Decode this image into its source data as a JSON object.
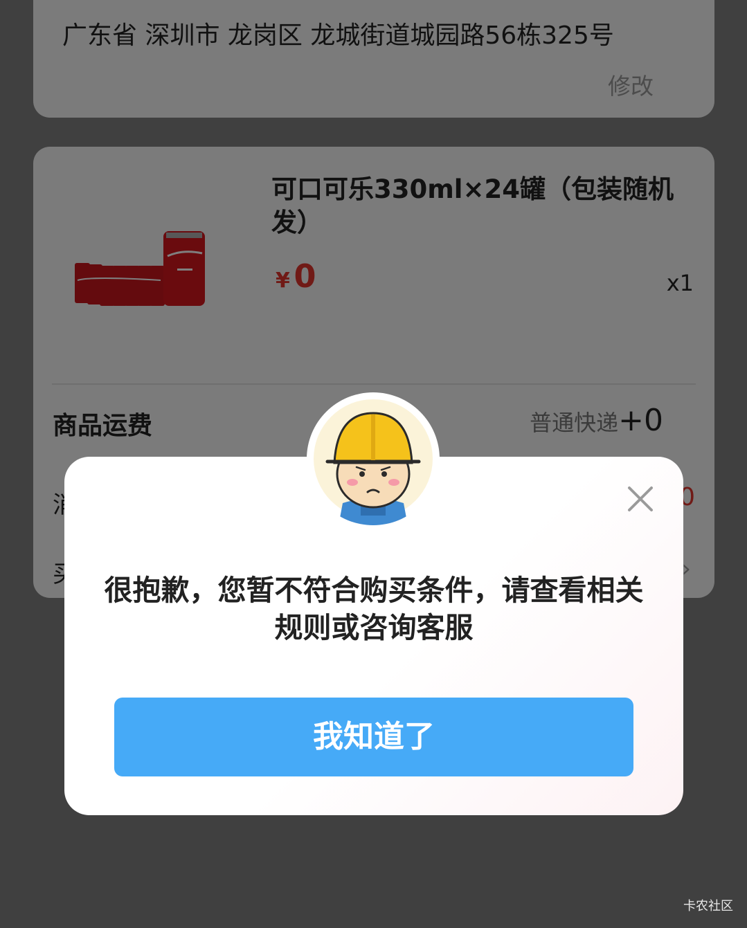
{
  "address": {
    "text": "广东省 深圳市 龙岗区 龙城街道城园路56栋325号",
    "edit_label": "修改"
  },
  "product": {
    "title": "可口可乐330ml×24罐（包装随机发）",
    "currency": "¥",
    "price": "0",
    "quantity": "x1",
    "image_icon": "coca-cola-pack-image"
  },
  "shipping": {
    "label": "商品运费",
    "method": "普通快递",
    "fee": "+0"
  },
  "row3": {
    "label_partial": "消",
    "value_partial": "0"
  },
  "row4": {
    "label_partial": "买",
    "chevron": "›"
  },
  "dialog": {
    "message": "很抱歉，您暂不符合购买条件，请查看相关规则或咨询客服",
    "button_label": "我知道了",
    "close_icon": "close-icon",
    "avatar_icon": "worker-mascot-avatar"
  },
  "watermark": "卡农社区",
  "colors": {
    "accent": "#46aaf7",
    "price": "#e0342c"
  }
}
